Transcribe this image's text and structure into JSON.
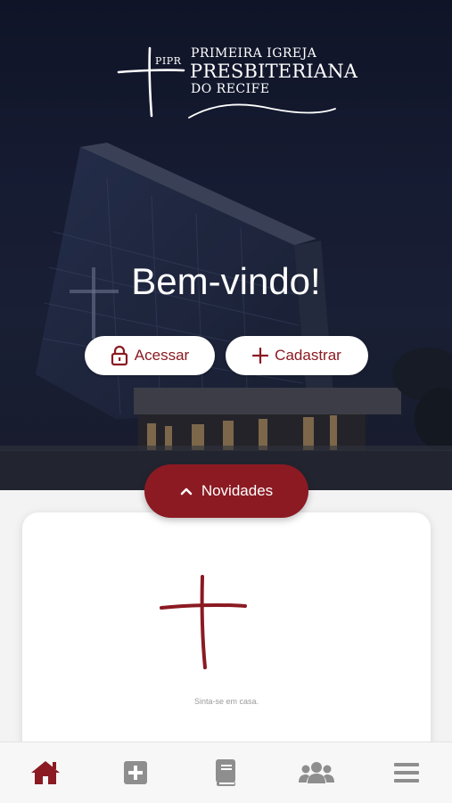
{
  "logo": {
    "abbr": "PIPR",
    "line1": "PRIMEIRA IGREJA",
    "line2": "PRESBITERIANA",
    "line3": "DO RECIFE"
  },
  "hero": {
    "welcome": "Bem-vindo!",
    "login_label": "Acessar",
    "signup_label": "Cadastrar"
  },
  "news_tab": {
    "label": "Novidades"
  },
  "card": {
    "caption": "Sinta-se em casa."
  },
  "bottom_nav": {
    "items": [
      "home-icon",
      "plus-square-icon",
      "book-icon",
      "users-icon",
      "menu-icon"
    ],
    "active_color": "#8b1a22",
    "inactive_color": "#8e8e8e"
  },
  "colors": {
    "accent": "#8b1a22",
    "hero_bg": "#1a2039"
  }
}
